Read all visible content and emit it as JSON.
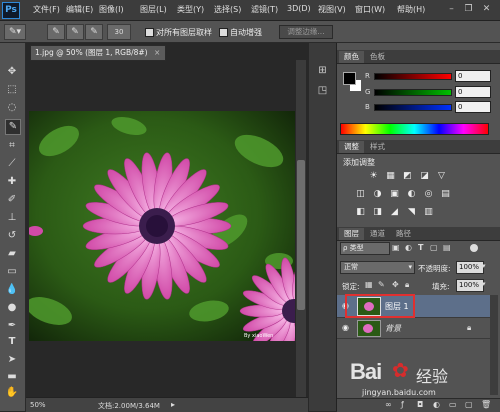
{
  "app": {
    "logo": "Ps"
  },
  "menu": [
    {
      "label": "文件(F)"
    },
    {
      "label": "编辑(E)"
    },
    {
      "label": "图像(I)"
    },
    {
      "label": "图层(L)"
    },
    {
      "label": "类型(Y)"
    },
    {
      "label": "选择(S)"
    },
    {
      "label": "滤镜(T)"
    },
    {
      "label": "3D(D)"
    },
    {
      "label": "视图(V)"
    },
    {
      "label": "窗口(W)"
    },
    {
      "label": "帮助(H)"
    }
  ],
  "window_controls": {
    "minimize": "–",
    "restore": "❐",
    "close": "✕"
  },
  "options_bar": {
    "brush_size": "30",
    "sample_all_layers": "对所有图层取样",
    "auto_enhance": "自动增强",
    "refine_edge": "调整边缘..."
  },
  "document": {
    "tab_title": "1.jpg @ 50% (图层 1, RGB/8#)",
    "tab_close": "×",
    "zoom": "50%",
    "doc_info": "文档:2.00M/3.64M",
    "photo_credit": "By xiaoWen"
  },
  "color_panel": {
    "tabs": [
      "颜色",
      "色板"
    ],
    "channels": [
      {
        "label": "R",
        "value": "0"
      },
      {
        "label": "G",
        "value": "0"
      },
      {
        "label": "B",
        "value": "0"
      }
    ]
  },
  "adjust_panel": {
    "tabs": [
      "调整",
      "样式"
    ],
    "title": "添加调整",
    "icons_row1": [
      "☀",
      "▦",
      "◩",
      "◪",
      "▽"
    ],
    "icons_row2": [
      "◫",
      "◑",
      "▣",
      "◐",
      "◎",
      "▤"
    ],
    "icons_row3": [
      "◧",
      "◨",
      "◢",
      "◥",
      "▥"
    ]
  },
  "layers_panel": {
    "tabs": [
      "图层",
      "通道",
      "路径"
    ],
    "filter_label": "ρ 类型",
    "blend_mode": "正常",
    "opacity_label": "不透明度:",
    "opacity_value": "100%",
    "lock_label": "锁定:",
    "fill_label": "填充:",
    "fill_value": "100%",
    "layers": [
      {
        "name": "图层 1",
        "selected": true
      },
      {
        "name": "背景",
        "selected": false
      }
    ]
  },
  "watermark": {
    "brand": "Bai",
    "brand2": "经验",
    "url": "jingyan.baidu.com"
  },
  "colors": {
    "accent_red": "#e03030",
    "selected_layer": "#5d6f8a",
    "ps_blue": "#2f89d8"
  }
}
